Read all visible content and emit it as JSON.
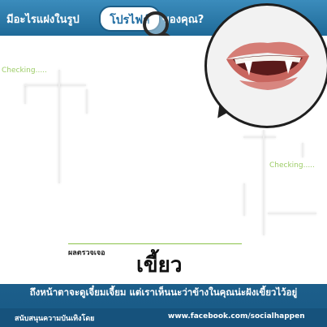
{
  "header": {
    "text_left": "มีอะไรแฝงในรูป",
    "text_highlight": "โปรไฟล์",
    "text_right": "ของคุณ?"
  },
  "checking_labels": [
    "Checking.....",
    "Checking....."
  ],
  "result": {
    "label": "ผลตรวจเจอ",
    "word": "เขี้ยว"
  },
  "caption": "ถึงหน้าตาจะดูเจี๋ยมเจี้ยม แต่เราเห็นนะว่าข้างในคุณน่ะฝังเขี้ยวไว้อยู่",
  "footer": {
    "sponsor_text": "สนับสนุนความบันเทิงโดย",
    "url": "www.facebook.com/socialhappen"
  },
  "colors": {
    "brand_blue": "#1f6a98",
    "checking_green": "#9ccc66",
    "result_line": "#8bc34a"
  }
}
